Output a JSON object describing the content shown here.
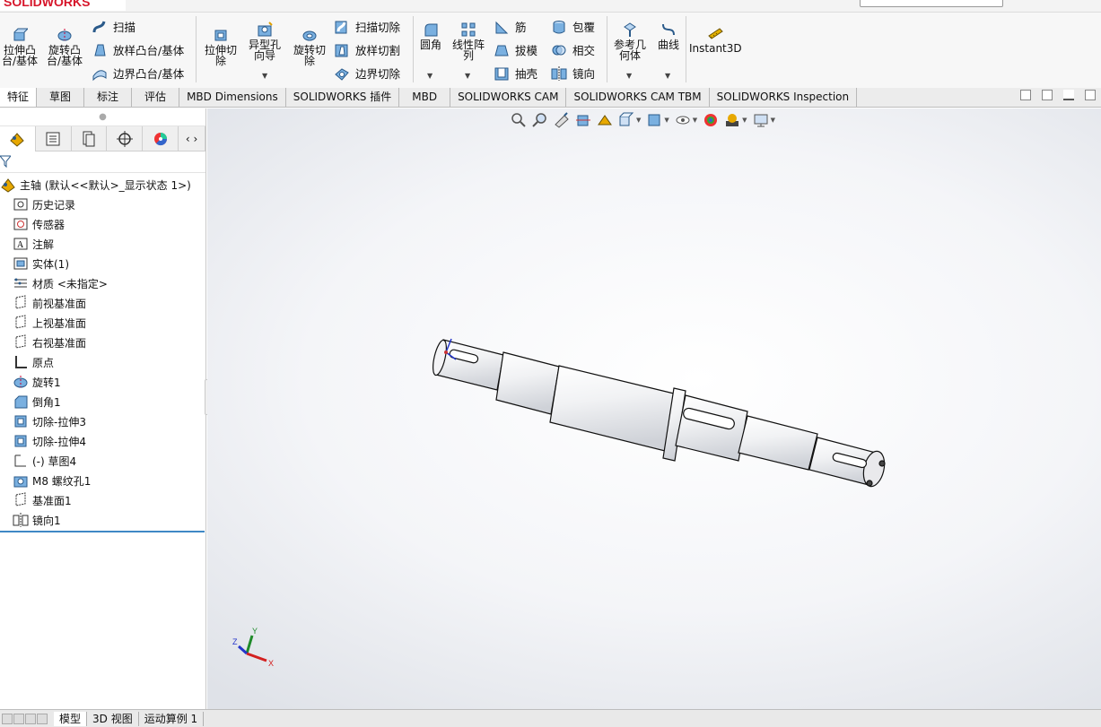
{
  "app": {
    "logo": "SOLIDWORKS"
  },
  "ribbon": {
    "extrude_boss": "拉伸凸\n台/基体",
    "revolve_boss": "旋转凸\n台/基体",
    "sweep": "扫描",
    "loft_boss": "放样凸台/基体",
    "boundary_boss": "边界凸台/基体",
    "extrude_cut": "拉伸切\n除",
    "hole_wizard": "异型孔\n向导",
    "revolve_cut": "旋转切\n除",
    "swept_cut": "扫描切除",
    "loft_cut": "放样切割",
    "boundary_cut": "边界切除",
    "fillet": "圆角",
    "linear_pattern": "线性阵\n列",
    "rib": "筋",
    "draft": "拔模",
    "shell": "抽壳",
    "wrap": "包覆",
    "intersect": "相交",
    "mirror": "镜向",
    "ref_geometry": "参考几\n何体",
    "curves": "曲线",
    "instant3d": "Instant3D"
  },
  "tabs": [
    {
      "label": "特征",
      "active": true
    },
    {
      "label": "草图",
      "active": false
    },
    {
      "label": "标注",
      "active": false
    },
    {
      "label": "评估",
      "active": false
    },
    {
      "label": "MBD Dimensions",
      "active": false
    },
    {
      "label": "SOLIDWORKS 插件",
      "active": false
    },
    {
      "label": "MBD",
      "active": false
    },
    {
      "label": "SOLIDWORKS CAM",
      "active": false
    },
    {
      "label": "SOLIDWORKS CAM TBM",
      "active": false
    },
    {
      "label": "SOLIDWORKS Inspection",
      "active": false
    }
  ],
  "tree": {
    "root": "主轴 (默认<<默认>_显示状态 1>)",
    "items": [
      {
        "label": "历史记录",
        "icon": "history-icon"
      },
      {
        "label": "传感器",
        "icon": "sensor-icon"
      },
      {
        "label": "注解",
        "icon": "annotation-icon"
      },
      {
        "label": "实体(1)",
        "icon": "solid-bodies-icon"
      },
      {
        "label": "材质 <未指定>",
        "icon": "material-icon"
      },
      {
        "label": "前视基准面",
        "icon": "plane-icon"
      },
      {
        "label": "上视基准面",
        "icon": "plane-icon"
      },
      {
        "label": "右视基准面",
        "icon": "plane-icon"
      },
      {
        "label": "原点",
        "icon": "origin-icon"
      },
      {
        "label": "旋转1",
        "icon": "revolve-icon"
      },
      {
        "label": "倒角1",
        "icon": "chamfer-icon"
      },
      {
        "label": "切除-拉伸3",
        "icon": "cut-extrude-icon"
      },
      {
        "label": "切除-拉伸4",
        "icon": "cut-extrude-icon"
      },
      {
        "label": "(-) 草图4",
        "icon": "sketch-icon"
      },
      {
        "label": "M8 螺纹孔1",
        "icon": "hole-icon"
      },
      {
        "label": "基准面1",
        "icon": "plane-icon"
      },
      {
        "label": "镜向1",
        "icon": "mirror-icon"
      }
    ]
  },
  "bottom_tabs": [
    {
      "label": "模型",
      "active": true
    },
    {
      "label": "3D 视图",
      "active": false
    },
    {
      "label": "运动算例 1",
      "active": false
    }
  ],
  "triad": {
    "x": "X",
    "y": "Y",
    "z": "Z"
  },
  "colors": {
    "accent": "#3f88c5",
    "logo_red": "#d7162b",
    "x_axis": "#d32020",
    "y_axis": "#1f8a2a",
    "z_axis": "#2435c9"
  }
}
